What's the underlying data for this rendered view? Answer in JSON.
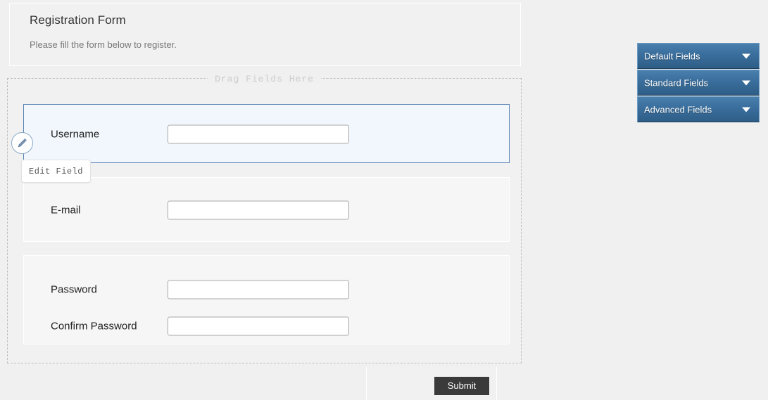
{
  "form": {
    "title": "Registration Form",
    "subtitle": "Please fill the form below to register.",
    "drop_zone_legend": "Drag Fields Here",
    "blocks": [
      {
        "id": "username",
        "selected": true,
        "rows": [
          {
            "label": "Username",
            "value": "",
            "placeholder": ""
          }
        ]
      },
      {
        "id": "email",
        "selected": false,
        "rows": [
          {
            "label": "E-mail",
            "value": "",
            "placeholder": ""
          }
        ]
      },
      {
        "id": "password",
        "selected": false,
        "rows": [
          {
            "label": "Password",
            "value": "",
            "placeholder": ""
          },
          {
            "label": "Confirm Password",
            "value": "",
            "placeholder": ""
          }
        ]
      }
    ],
    "submit_label": "Submit"
  },
  "edit_handle": {
    "icon": "pencil-icon",
    "tooltip": "Edit Field"
  },
  "sidebar": {
    "panels": [
      {
        "label": "Default Fields",
        "icon": "chevron-down-icon"
      },
      {
        "label": "Standard Fields",
        "icon": "chevron-down-icon"
      },
      {
        "label": "Advanced Fields",
        "icon": "chevron-down-icon"
      }
    ]
  },
  "colors": {
    "page_background": "#f0f0f0",
    "panel_background": "#f1f1f1",
    "selected_field_background": "#f2f7fd",
    "selected_field_border": "#5e86b4",
    "accent_blue": "#3a6e9c",
    "submit_button": "#3a3a3a",
    "drop_zone_border": "#bdbdbd"
  }
}
